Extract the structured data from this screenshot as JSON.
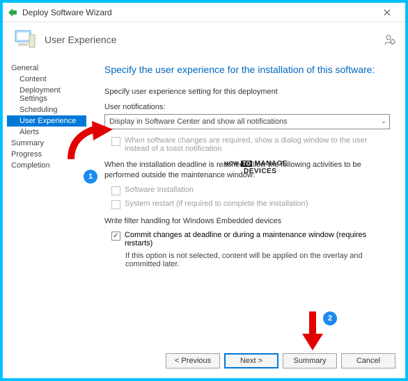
{
  "titlebar": {
    "title": "Deploy Software Wizard"
  },
  "header": {
    "page_title": "User Experience"
  },
  "sidebar": {
    "items": [
      {
        "label": "General",
        "indent": false
      },
      {
        "label": "Content",
        "indent": true
      },
      {
        "label": "Deployment Settings",
        "indent": true
      },
      {
        "label": "Scheduling",
        "indent": true
      },
      {
        "label": "User Experience",
        "indent": true,
        "selected": true
      },
      {
        "label": "Alerts",
        "indent": true
      },
      {
        "label": "Summary",
        "indent": false
      },
      {
        "label": "Progress",
        "indent": false
      },
      {
        "label": "Completion",
        "indent": false
      }
    ]
  },
  "content": {
    "heading": "Specify the user experience for the installation of this software:",
    "desc": "Specify user experience setting for this deployment",
    "notif_label": "User notifications:",
    "notif_value": "Display in Software Center and show all notifications",
    "dialog_cb": "When software changes are required, show a dialog window to the user instead of a toast notification",
    "deadline_text": "When the installation deadline is reached, allow the following activities to be performed outside the maintenance window:",
    "cb_install": "Software Installation",
    "cb_restart": "System restart  (if required to complete the installation)",
    "filter_label": "Write filter handling for Windows Embedded devices",
    "cb_commit": "Commit changes at deadline or during a maintenance window (requires restarts)",
    "commit_note": "If this option is not selected, content will be applied on the overlay and committed later."
  },
  "footer": {
    "previous": "< Previous",
    "next": "Next >",
    "summary": "Summary",
    "cancel": "Cancel"
  },
  "annotations": {
    "badge1": "1",
    "badge2": "2"
  },
  "watermark": {
    "l1": "HOW",
    "l2": "MANAGE",
    "l3": "DEVICES",
    "to": "TO"
  }
}
